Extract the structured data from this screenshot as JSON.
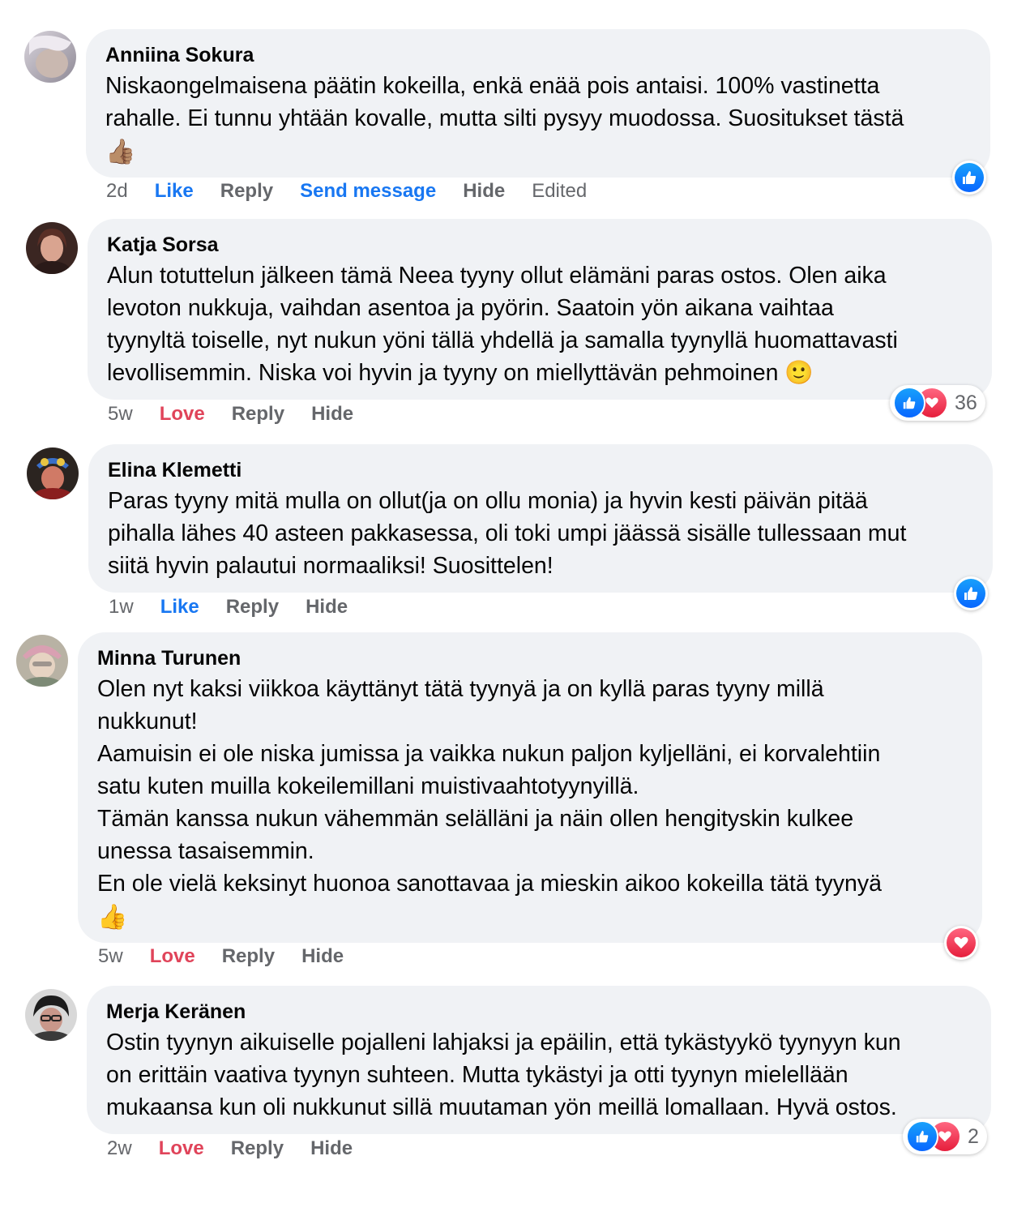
{
  "comments": [
    {
      "author": "Anniina Sokura",
      "lines": [
        "Niskaongelmaisena päätin kokeilla, enkä enää pois antaisi. 100% vastinetta",
        "rahalle. Ei tunnu yhtään kovalle, mutta silti pysyy muodossa. Suositukset tästä"
      ],
      "emoji": "👍🏽",
      "time": "2d",
      "reaction_label": "Like",
      "reply": "Reply",
      "send_message": "Send message",
      "hide": "Hide",
      "edited": "Edited",
      "reactions": [
        "like"
      ],
      "reaction_count": ""
    },
    {
      "author": "Katja Sorsa",
      "lines": [
        "Alun totuttelun jälkeen tämä Neea tyyny ollut elämäni paras ostos. Olen aika",
        "levoton nukkuja, vaihdan asentoa ja pyörin. Saatoin yön aikana vaihtaa",
        "tyynyltä toiselle, nyt nukun yöni tällä yhdellä ja samalla tyynyllä huomattavasti",
        "levollisemmin. Niska voi hyvin ja tyyny on miellyttävän pehmoinen 🙂"
      ],
      "time": "5w",
      "reaction_label": "Love",
      "reply": "Reply",
      "hide": "Hide",
      "reactions": [
        "like",
        "love"
      ],
      "reaction_count": "36"
    },
    {
      "author": "Elina Klemetti",
      "lines": [
        "Paras tyyny mitä mulla on ollut(ja on ollu monia) ja hyvin kesti päivän pitää",
        "pihalla lähes 40 asteen pakkasessa, oli toki umpi jäässä sisälle tullessaan mut",
        "siitä hyvin palautui normaaliksi! Suosittelen!"
      ],
      "time": "1w",
      "reaction_label": "Like",
      "reply": "Reply",
      "hide": "Hide",
      "reactions": [
        "like"
      ],
      "reaction_count": ""
    },
    {
      "author": "Minna Turunen",
      "lines": [
        "Olen nyt kaksi viikkoa käyttänyt tätä tyynyä ja on kyllä paras tyyny millä",
        "nukkunut!",
        "Aamuisin ei ole niska jumissa ja vaikka nukun paljon kyljelläni, ei korvalehtiin",
        "satu kuten muilla kokeilemillani muistivaahtotyynyillä.",
        "Tämän kanssa nukun vähemmän selälläni ja näin ollen hengityskin kulkee",
        "unessa tasaisemmin.",
        "En ole vielä keksinyt huonoa sanottavaa ja mieskin aikoo kokeilla tätä tyynyä"
      ],
      "emoji": "👍",
      "time": "5w",
      "reaction_label": "Love",
      "reply": "Reply",
      "hide": "Hide",
      "reactions": [
        "love"
      ],
      "reaction_count": ""
    },
    {
      "author": "Merja Keränen",
      "lines": [
        "Ostin tyynyn aikuiselle pojalleni lahjaksi ja epäilin, että tykästyykö tyynyyn kun",
        "on erittäin vaativa tyynyn suhteen. Mutta tykästyi ja otti tyynyn mielellään",
        "mukaansa kun oli nukkunut sillä muutaman yön meillä lomallaan. Hyvä ostos."
      ],
      "time": "2w",
      "reaction_label": "Love",
      "reply": "Reply",
      "hide": "Hide",
      "reactions": [
        "like",
        "love"
      ],
      "reaction_count": "2"
    }
  ],
  "colors": {
    "bubble": "#f0f2f5",
    "like_blue": "#1877f2",
    "love_red": "#e0445a",
    "meta_gray": "#65676b"
  }
}
